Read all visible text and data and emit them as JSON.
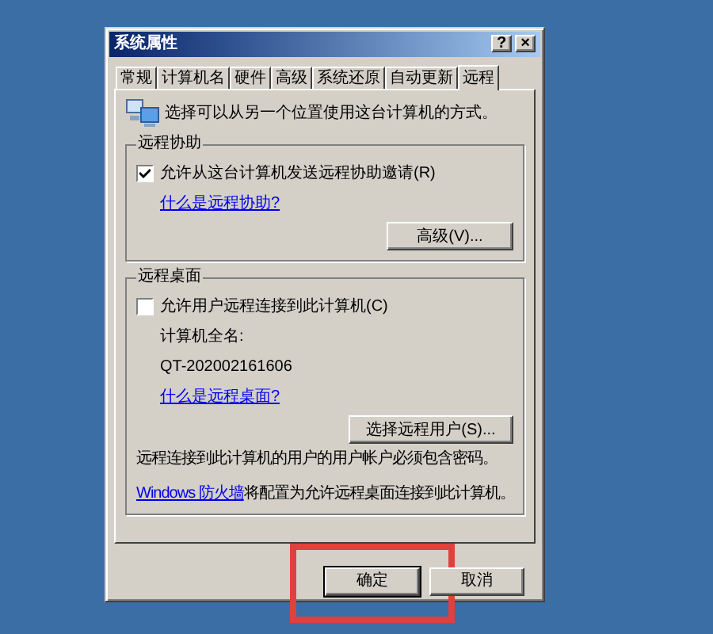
{
  "window": {
    "title": "系统属性",
    "title_buttons": [
      "?",
      "×"
    ]
  },
  "tabs": [
    {
      "label": "常规",
      "selected": false
    },
    {
      "label": "计算机名",
      "selected": false
    },
    {
      "label": "硬件",
      "selected": false
    },
    {
      "label": "高级",
      "selected": false
    },
    {
      "label": "系统还原",
      "selected": false
    },
    {
      "label": "自动更新",
      "selected": false
    },
    {
      "label": "远程",
      "selected": true
    }
  ],
  "intro": "选择可以从另一个位置使用这台计算机的方式。",
  "remote_assistance": {
    "title": "远程协助",
    "checkbox": {
      "label": "允许从这台计算机发送远程协助邀请(R)",
      "checked": true
    },
    "link": "什么是远程协助?",
    "button": "高级(V)..."
  },
  "remote_desktop": {
    "title": "远程桌面",
    "checkbox": {
      "label": "允许用户远程连接到此计算机(C)",
      "checked": false
    },
    "computer_name_label": "计算机全名:",
    "computer_name": "QT-202002161606",
    "link": "什么是远程桌面?",
    "button": "选择远程用户(S)...",
    "password_note": "远程连接到此计算机的用户的用户帐户必须包含密码。",
    "firewall_note": {
      "link": "Windows 防火墙",
      "text": "将配置为允许远程桌面连接到此计算机。"
    }
  },
  "buttons": [
    {
      "label": "确定",
      "highlighted": true
    },
    {
      "label": "取消",
      "highlighted": false
    }
  ]
}
